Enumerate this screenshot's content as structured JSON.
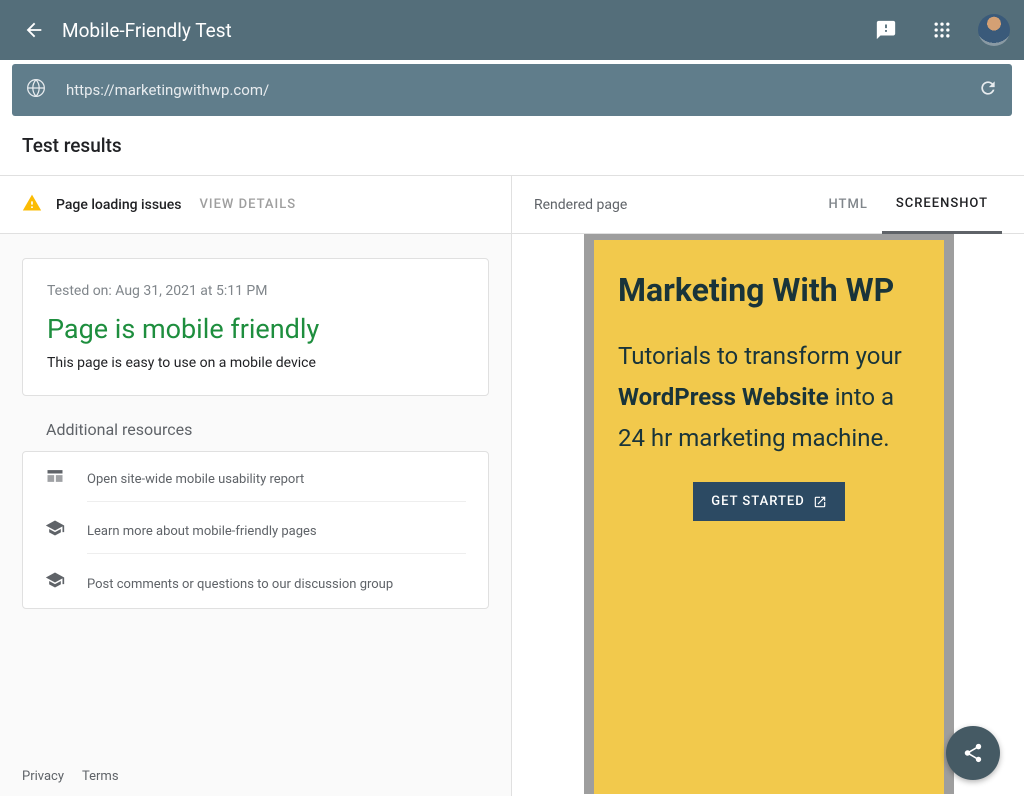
{
  "header": {
    "title": "Mobile-Friendly Test"
  },
  "urlbar": {
    "url": "https://marketingwithwp.com/"
  },
  "section": {
    "title": "Test results"
  },
  "issues": {
    "text": "Page loading issues",
    "view_details": "VIEW DETAILS"
  },
  "result": {
    "tested_on": "Tested on: Aug 31, 2021 at 5:11 PM",
    "verdict": "Page is mobile friendly",
    "subtext": "This page is easy to use on a mobile device"
  },
  "additional": {
    "title": "Additional resources",
    "items": [
      {
        "label": "Open site-wide mobile usability report"
      },
      {
        "label": "Learn more about mobile-friendly pages"
      },
      {
        "label": "Post comments or questions to our discussion group"
      }
    ]
  },
  "footer": {
    "privacy": "Privacy",
    "terms": "Terms"
  },
  "right": {
    "title": "Rendered page",
    "tab_html": "HTML",
    "tab_screenshot": "SCREENSHOT"
  },
  "preview": {
    "title": "Marketing With WP",
    "sub_pre": "Tutorials to transform your ",
    "sub_bold": "WordPress Website",
    "sub_post": " into a 24 hr marketing machine.",
    "cta": "GET STARTED"
  }
}
